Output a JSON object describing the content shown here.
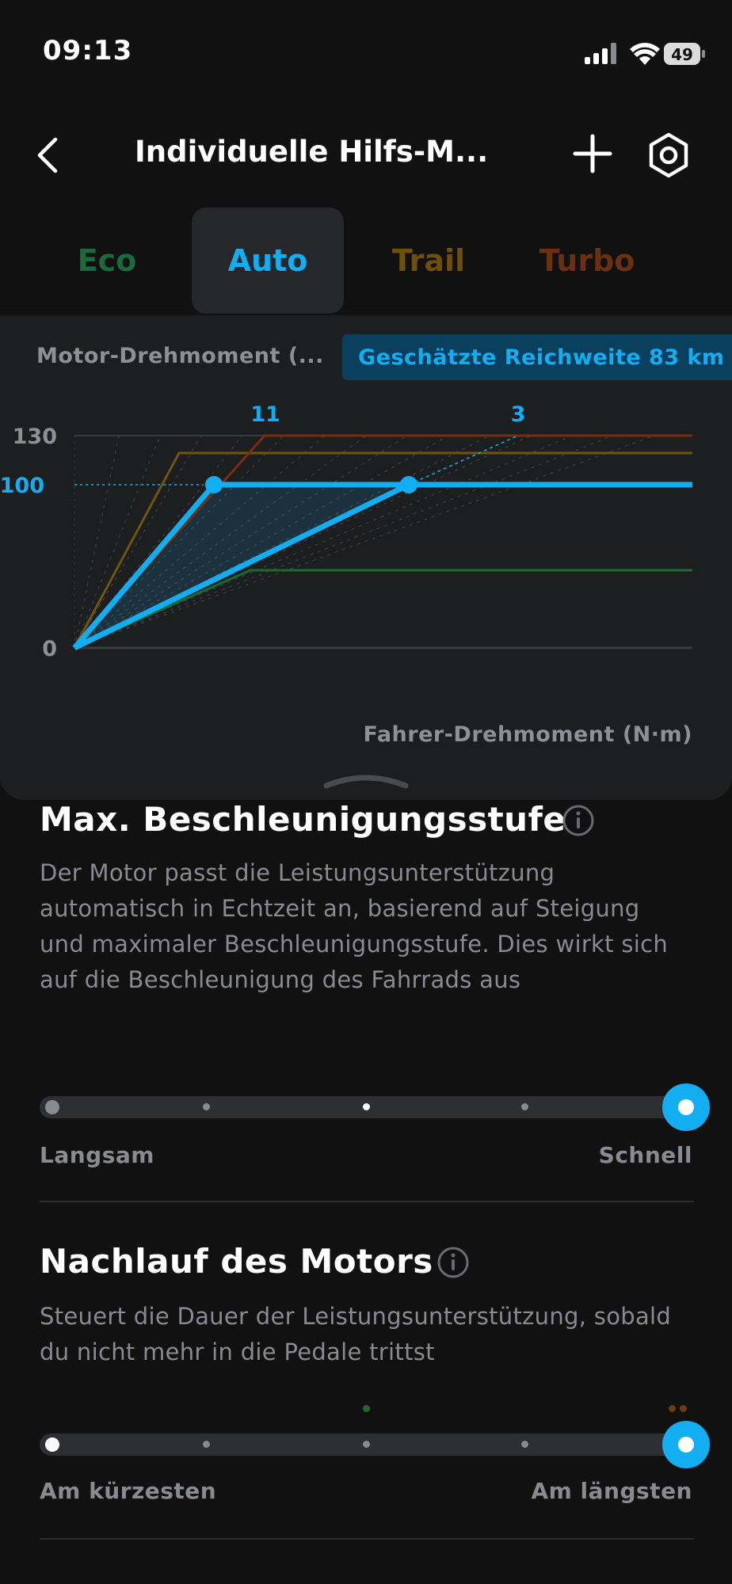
{
  "status": {
    "time": "09:13",
    "battery": "49"
  },
  "nav": {
    "title": "Individuelle Hilfs-M..."
  },
  "tabs": [
    {
      "label": "Eco",
      "color": "#1a6a3e",
      "active": false
    },
    {
      "label": "Auto",
      "color": "#13adf2",
      "active": true
    },
    {
      "label": "Trail",
      "color": "#6e4f0e",
      "active": false
    },
    {
      "label": "Turbo",
      "color": "#6a3010",
      "active": false
    }
  ],
  "chart_header": {
    "inactive_chip": "Motor-Drehmoment (...",
    "active_chip": "Geschätzte Reichweite 83 km ›"
  },
  "chart_data": {
    "type": "line",
    "xlabel": "Fahrer-Drehmoment (N·m)",
    "y_ticks": [
      "130",
      "100",
      "0"
    ],
    "highlight_y": "100",
    "top_labels": [
      "11",
      "3"
    ],
    "series": [
      {
        "color": "#1b6a35",
        "points": [
          [
            0,
            0
          ],
          [
            0.29,
            50
          ],
          [
            1,
            50
          ]
        ]
      },
      {
        "color": "#6e5510",
        "points": [
          [
            0,
            0
          ],
          [
            0.17,
            112
          ],
          [
            1,
            112
          ]
        ]
      },
      {
        "color": "#7a2e0e",
        "points": [
          [
            0,
            0
          ],
          [
            0.31,
            130
          ],
          [
            1,
            130
          ]
        ]
      },
      {
        "color": "#13adf2",
        "points": [
          [
            0,
            0
          ],
          [
            0.23,
            100
          ],
          [
            1,
            100
          ]
        ]
      },
      {
        "color": "#13adf2",
        "points": [
          [
            0,
            0
          ],
          [
            0.54,
            100
          ],
          [
            1,
            100
          ]
        ]
      }
    ]
  },
  "accel": {
    "title": "Max. Beschleunigungsstufe",
    "desc": "Der Motor passt die Leistungsunterstützung automatisch in Echtzeit an, basierend auf Steigung und maximaler Beschleunigungsstufe. Dies wirkt sich auf die Beschleunigung des Fahrrads aus",
    "min_label": "Langsam",
    "max_label": "Schnell",
    "level": "5 of 5"
  },
  "overrun": {
    "title": "Nachlauf des Motors",
    "desc": "Steuert die Dauer der Leistungsunterstützung, sobald du nicht mehr in die Pedale trittst",
    "min_label": "Am kürzesten",
    "max_label": "Am längsten",
    "level": "5 of 5"
  },
  "colors": {
    "accent": "#13adf2",
    "background": "#111112",
    "card": "#1d1e20"
  }
}
